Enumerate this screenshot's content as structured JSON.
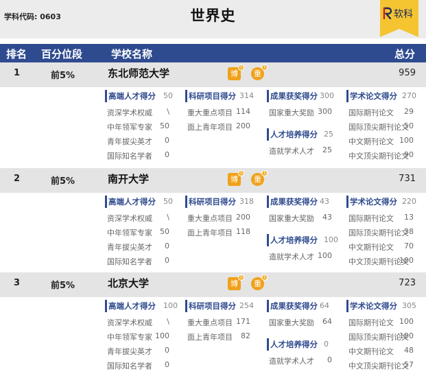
{
  "header_top": {
    "subject_code": "学科代码: 0603",
    "title": "世界史",
    "brand_text": "软科"
  },
  "columns": {
    "rank": "排名",
    "percentile": "百分位段",
    "school": "学校名称",
    "total": "总分"
  },
  "badges": {
    "bo": "博",
    "zhong": "重",
    "dot": "i"
  },
  "rows": [
    {
      "rank": "1",
      "percentile": "前5%",
      "school": "东北师范大学",
      "total": "959",
      "talent_high": {
        "label": "高端人才得分",
        "value": "50",
        "items": [
          {
            "name": "资深学术权威",
            "value": "\\"
          },
          {
            "name": "中年领军专家",
            "value": "50"
          },
          {
            "name": "青年拔尖英才",
            "value": "0"
          },
          {
            "name": "国际知名学者",
            "value": "0"
          }
        ]
      },
      "research": {
        "label": "科研项目得分",
        "value": "314",
        "items": [
          {
            "name": "重大重点项目",
            "value": "114"
          },
          {
            "name": "面上青年项目",
            "value": "200"
          }
        ]
      },
      "awards": {
        "label": "成果获奖得分",
        "value": "300",
        "items": [
          {
            "name": "国家重大奖励",
            "value": "300"
          }
        ]
      },
      "training": {
        "label": "人才培养得分",
        "value": "25",
        "items": [
          {
            "name": "造就学术人才",
            "value": "25"
          }
        ]
      },
      "papers": {
        "label": "学术论文得分",
        "value": "270",
        "items": [
          {
            "name": "国际期刊论文",
            "value": "29"
          },
          {
            "name": "国际顶尖期刊论文",
            "value": "50"
          },
          {
            "name": "中文期刊论文",
            "value": "100"
          },
          {
            "name": "中文顶尖期刊论文",
            "value": "90"
          }
        ]
      }
    },
    {
      "rank": "2",
      "percentile": "前5%",
      "school": "南开大学",
      "total": "731",
      "talent_high": {
        "label": "高端人才得分",
        "value": "50",
        "items": [
          {
            "name": "资深学术权威",
            "value": "\\"
          },
          {
            "name": "中年领军专家",
            "value": "50"
          },
          {
            "name": "青年拔尖英才",
            "value": "0"
          },
          {
            "name": "国际知名学者",
            "value": "0"
          }
        ]
      },
      "research": {
        "label": "科研项目得分",
        "value": "318",
        "items": [
          {
            "name": "重大重点项目",
            "value": "200"
          },
          {
            "name": "面上青年项目",
            "value": "118"
          }
        ]
      },
      "awards": {
        "label": "成果获奖得分",
        "value": "43",
        "items": [
          {
            "name": "国家重大奖励",
            "value": "43"
          }
        ]
      },
      "training": {
        "label": "人才培养得分",
        "value": "100",
        "items": [
          {
            "name": "造就学术人才",
            "value": "100"
          }
        ]
      },
      "papers": {
        "label": "学术论文得分",
        "value": "220",
        "items": [
          {
            "name": "国际期刊论文",
            "value": "13"
          },
          {
            "name": "国际顶尖期刊论文",
            "value": "38"
          },
          {
            "name": "中文期刊论文",
            "value": "70"
          },
          {
            "name": "中文顶尖期刊论文",
            "value": "100"
          }
        ]
      }
    },
    {
      "rank": "3",
      "percentile": "前5%",
      "school": "北京大学",
      "total": "723",
      "talent_high": {
        "label": "高端人才得分",
        "value": "100",
        "items": [
          {
            "name": "资深学术权威",
            "value": "\\"
          },
          {
            "name": "中年领军专家",
            "value": "100"
          },
          {
            "name": "青年拔尖英才",
            "value": "0"
          },
          {
            "name": "国际知名学者",
            "value": "0"
          }
        ]
      },
      "research": {
        "label": "科研项目得分",
        "value": "254",
        "items": [
          {
            "name": "重大重点项目",
            "value": "171"
          },
          {
            "name": "面上青年项目",
            "value": "82"
          }
        ]
      },
      "awards": {
        "label": "成果获奖得分",
        "value": "64",
        "items": [
          {
            "name": "国家重大奖励",
            "value": "64"
          }
        ]
      },
      "training": {
        "label": "人才培养得分",
        "value": "0",
        "items": [
          {
            "name": "造就学术人才",
            "value": "0"
          }
        ]
      },
      "papers": {
        "label": "学术论文得分",
        "value": "305",
        "items": [
          {
            "name": "国际期刊论文",
            "value": "100"
          },
          {
            "name": "国际顶尖期刊论文",
            "value": "100"
          },
          {
            "name": "中文期刊论文",
            "value": "48"
          },
          {
            "name": "中文顶尖期刊论文",
            "value": "57"
          }
        ]
      }
    }
  ]
}
